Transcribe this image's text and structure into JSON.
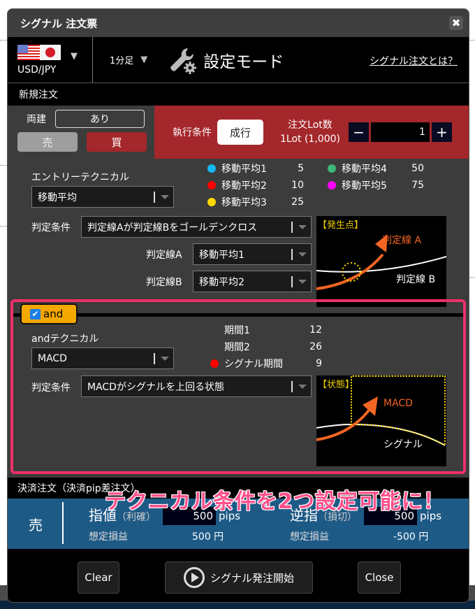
{
  "dialog": {
    "title": "シグナル 注文票",
    "close_icon": "close-icon"
  },
  "toolbar": {
    "currency_pair": "USD/JPY",
    "timeframe": "1分足",
    "mode_label": "設定モード",
    "help_link": "シグナル注文とは？"
  },
  "new_order": {
    "section_label": "新規注文",
    "hedge_label": "両建",
    "hedge_value": "あり",
    "sell_label": "売",
    "buy_label": "買",
    "exec_condition_label": "執行条件",
    "exec_condition_value": "成行",
    "lot_label": "注文Lot数",
    "lot_unit": "1Lot (1,000)",
    "lot_value": "1",
    "minus_label": "−",
    "plus_label": "+"
  },
  "entry": {
    "technical_label": "エントリーテクニカル",
    "technical_value": "移動平均",
    "condition_label": "判定条件",
    "condition_value": "判定線Aが判定線Bをゴールデンクロス",
    "line_a_label": "判定線A",
    "line_a_value": "移動平均1",
    "line_b_label": "判定線B",
    "line_b_value": "移動平均2",
    "moving_averages": [
      {
        "name": "移動平均1",
        "period": "5",
        "color": "#16b8f5"
      },
      {
        "name": "移動平均2",
        "period": "10",
        "color": "#ff0000"
      },
      {
        "name": "移動平均3",
        "period": "25",
        "color": "#ffd800"
      },
      {
        "name": "移動平均4",
        "period": "50",
        "color": "#3cb878"
      },
      {
        "name": "移動平均5",
        "period": "75",
        "color": "#ff00ff"
      }
    ],
    "diagram": {
      "tag": "【発生点】",
      "line_a": "判定線 A",
      "line_b": "判定線 B"
    }
  },
  "and_section": {
    "checkbox_label": "and",
    "checked": true,
    "technical_label": "andテクニカル",
    "technical_value": "MACD",
    "condition_label": "判定条件",
    "condition_value": "MACDがシグナルを上回る状態",
    "params": [
      {
        "name": "期間1",
        "value": "12",
        "dot": false
      },
      {
        "name": "期間2",
        "value": "26",
        "dot": false
      },
      {
        "name": "シグナル期間",
        "value": "9",
        "dot": true,
        "color": "#ff0000"
      }
    ],
    "diagram": {
      "tag": "【状態】",
      "line_macd": "MACD",
      "line_signal": "シグナル"
    }
  },
  "settlement": {
    "section_label": "決済注文（決済pip差注文）",
    "side": "売",
    "limit_label": "指値",
    "limit_sub": "（利確）",
    "limit_value": "500",
    "limit_unit": "pips",
    "limit_pl_label": "想定損益",
    "limit_pl_value": "500 円",
    "stop_label": "逆指",
    "stop_sub": "（損切）",
    "stop_value": "500",
    "stop_unit": "pips",
    "stop_pl_label": "想定損益",
    "stop_pl_value": "-500 円"
  },
  "promo_banner": "テクニカル条件を2つ設定可能に！",
  "footer": {
    "clear_label": "Clear",
    "start_label": "シグナル発注開始",
    "close_label": "Close"
  },
  "colors": {
    "accent_red": "#a4272b",
    "highlight_pink": "#f0306a",
    "and_chip": "#f4a800",
    "settle_blue": "#1e5a86"
  }
}
